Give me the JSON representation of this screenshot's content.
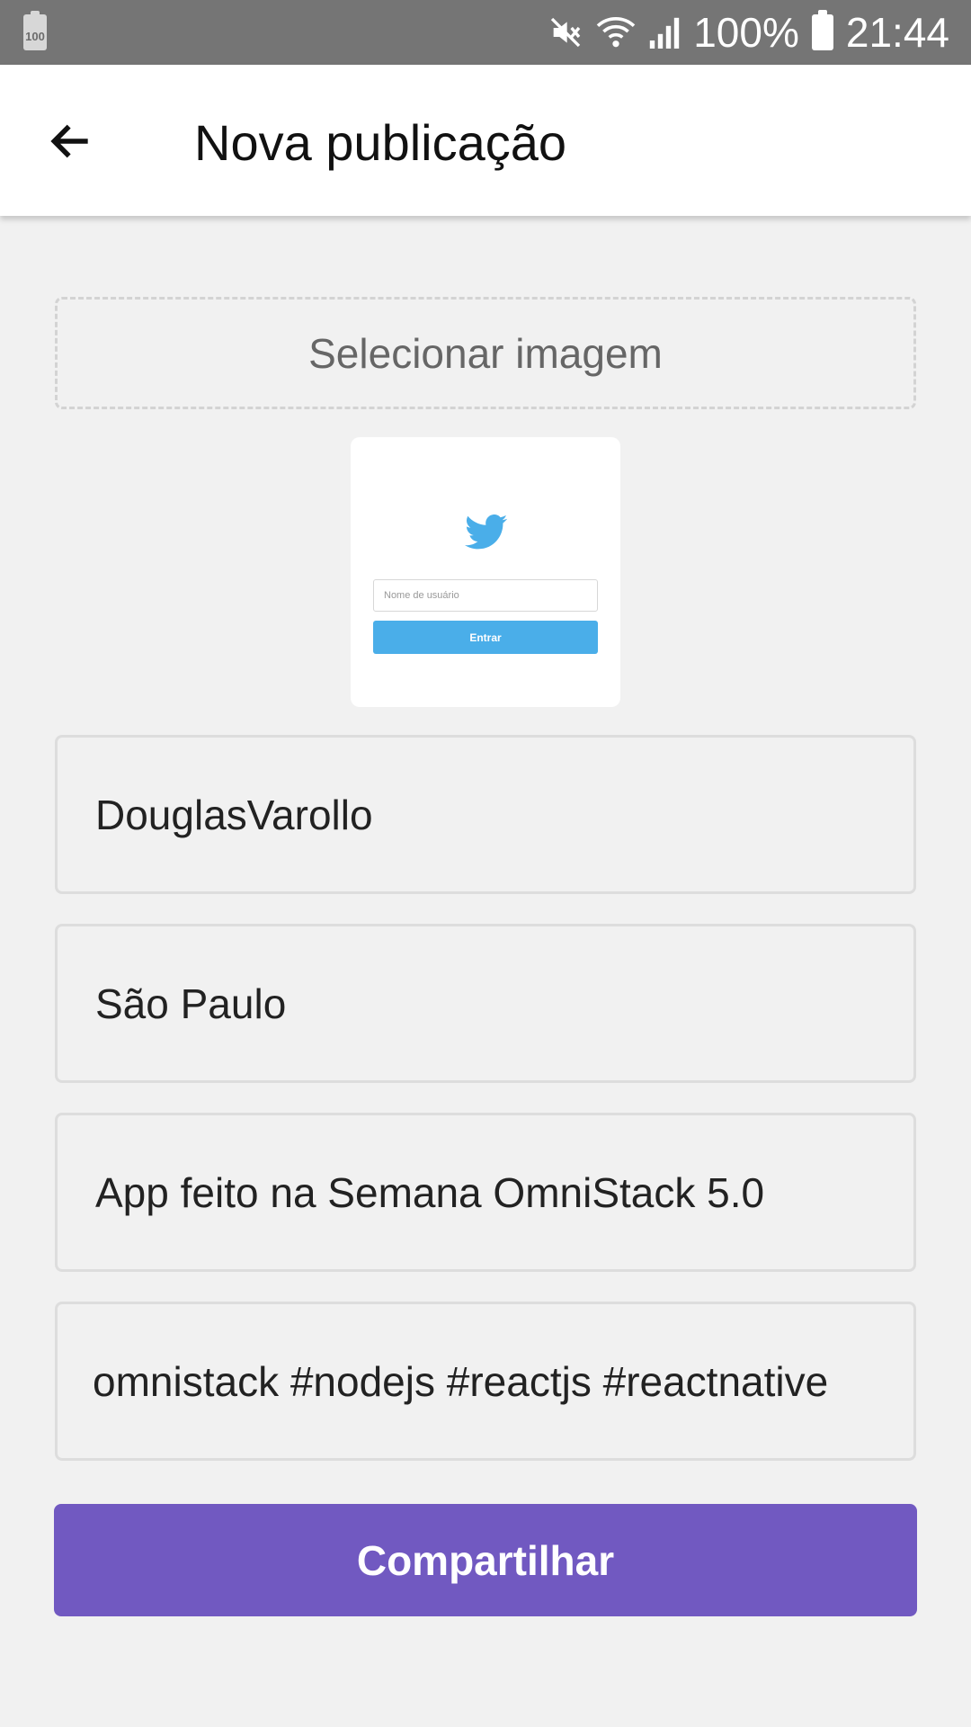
{
  "status_bar": {
    "left_battery_label": "100",
    "battery_percent": "100%",
    "time": "21:44",
    "icons": [
      "battery-icon",
      "mute-icon",
      "wifi-icon",
      "signal-icon",
      "battery-icon"
    ]
  },
  "app_bar": {
    "title": "Nova publicação",
    "back_icon": "arrow-left-icon"
  },
  "select_image": {
    "label": "Selecionar imagem"
  },
  "preview": {
    "icon": "twitter-bird-icon",
    "input_placeholder": "Nome de usuário",
    "button_label": "Entrar",
    "accent_color": "#4aaee9"
  },
  "form": {
    "author": "DouglasVarollo",
    "place": "São Paulo",
    "description": "App feito na Semana OmniStack 5.0",
    "hashtags": "omnistack #nodejs #reactjs #reactnative"
  },
  "share_button": {
    "label": "Compartilhar",
    "color": "#7159c1"
  }
}
